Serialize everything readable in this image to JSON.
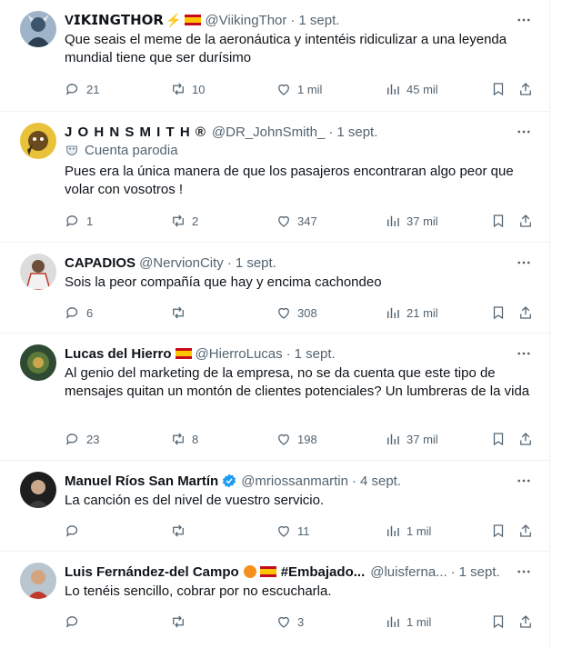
{
  "colors": {
    "text": "#0f1419",
    "muted": "#536471",
    "divider": "#eff3f4",
    "verified": "#1d9bf0"
  },
  "tweets": [
    {
      "display_name": "V𝗜𝗞𝗜𝗡𝗚𝗧𝗛𝗢𝗥",
      "handle": "@ViikingThor",
      "date": "1 sept.",
      "text": "Que seais el meme de la aeronáutica y intentéis ridiculizar a una leyenda mundial tiene que ser durísimo",
      "replies": "21",
      "reposts": "10",
      "likes": "1 mil",
      "views": "45 mil"
    },
    {
      "display_name": "J O H N  S M I T H ®",
      "handle": "@DR_JohnSmith_",
      "date": "1 sept.",
      "parody_label": "Cuenta parodia",
      "text": "Pues era la única manera de que los pasajeros encontraran algo peor que volar con vosotros !",
      "replies": "1",
      "reposts": "2",
      "likes": "347",
      "views": "37 mil"
    },
    {
      "display_name": "CAPADIOS",
      "handle": "@NervionCity",
      "date": "1 sept.",
      "text": "Sois la peor compañía que hay y encima cachondeo",
      "replies": "6",
      "reposts": "",
      "likes": "308",
      "views": "21 mil"
    },
    {
      "display_name": "Lucas del Hierro",
      "handle": "@HierroLucas",
      "date": "1 sept.",
      "text": "Al genio del marketing de la empresa, no se da cuenta que este tipo de mensajes quitan un montón de clientes potenciales? Un lumbreras de la vida",
      "replies": "23",
      "reposts": "8",
      "likes": "198",
      "views": "37 mil"
    },
    {
      "display_name": "Manuel Ríos San Martín",
      "handle": "@mriossanmartin",
      "date": "4 sept.",
      "text": "La canción es del nivel de vuestro servicio.",
      "replies": "",
      "reposts": "",
      "likes": "11",
      "views": "1 mil"
    },
    {
      "display_name": "Luis Fernández-del Campo",
      "display_name_suffix": "#Embajado...",
      "handle": "@luisferna...",
      "date": "1 sept.",
      "text": "Lo tenéis sencillo, cobrar por no escucharla.",
      "replies": "",
      "reposts": "",
      "likes": "3",
      "views": "1 mil"
    }
  ]
}
